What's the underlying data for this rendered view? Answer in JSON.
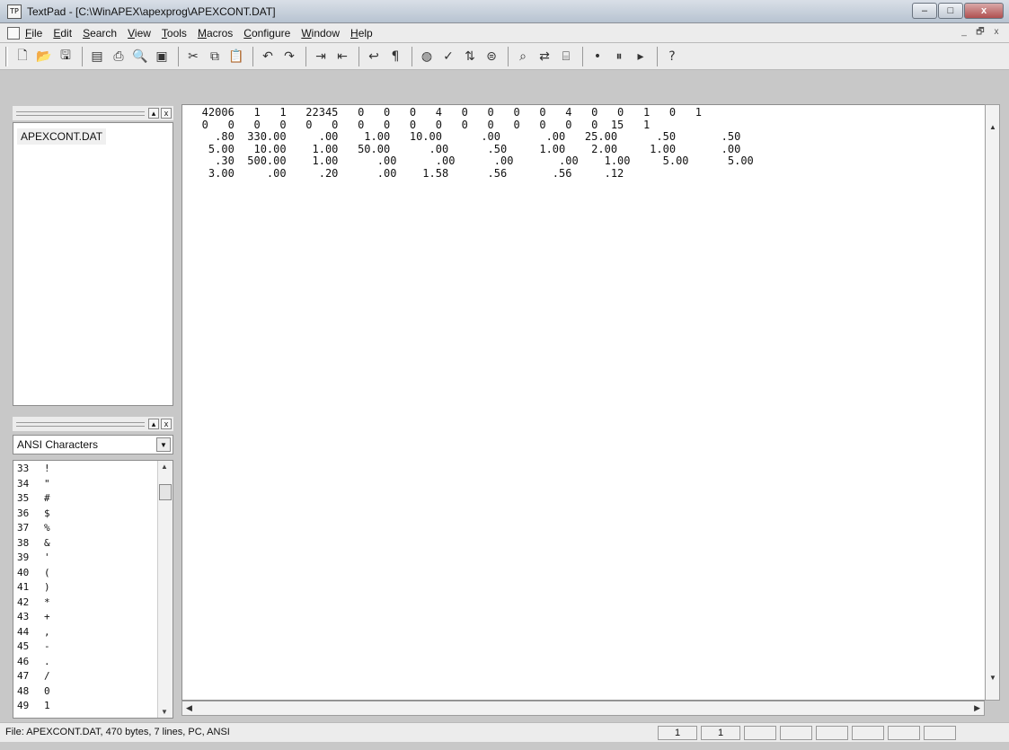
{
  "window": {
    "title": "TextPad - [C:\\WinAPEX\\apexprog\\APEXCONT.DAT]",
    "app_icon": "TP"
  },
  "window_controls": {
    "minimize": "–",
    "maximize": "□",
    "close": "x"
  },
  "menu": {
    "items": [
      "File",
      "Edit",
      "Search",
      "View",
      "Tools",
      "Macros",
      "Configure",
      "Window",
      "Help"
    ],
    "mdi_controls": {
      "minimize": "_",
      "restore": "🗗",
      "close": "x"
    }
  },
  "toolbar": {
    "icons": [
      "new-icon",
      "open-icon",
      "save-icon",
      "save-all-icon",
      "print-icon",
      "print-preview-icon",
      "manage-files-icon",
      "cut-icon",
      "copy-icon",
      "paste-icon",
      "undo-icon",
      "redo-icon",
      "indent-icon",
      "outdent-icon",
      "word-wrap-icon",
      "visible-spaces-icon",
      "web-icon",
      "spelling-icon",
      "sort-icon",
      "compare-icon",
      "find-icon",
      "replace-icon",
      "find-in-files-icon",
      "bookmark-icon",
      "record-macro-icon",
      "play-macro-icon",
      "context-help-icon"
    ]
  },
  "doc_panel": {
    "items": [
      "APEXCONT.DAT"
    ]
  },
  "char_panel": {
    "selected": "ANSI Characters",
    "rows": [
      {
        "code": "33",
        "char": "!"
      },
      {
        "code": "34",
        "char": "\""
      },
      {
        "code": "35",
        "char": "#"
      },
      {
        "code": "36",
        "char": "$"
      },
      {
        "code": "37",
        "char": "%"
      },
      {
        "code": "38",
        "char": "&"
      },
      {
        "code": "39",
        "char": "'"
      },
      {
        "code": "40",
        "char": "("
      },
      {
        "code": "41",
        "char": ")"
      },
      {
        "code": "42",
        "char": "*"
      },
      {
        "code": "43",
        "char": "+"
      },
      {
        "code": "44",
        "char": ","
      },
      {
        "code": "45",
        "char": "-"
      },
      {
        "code": "46",
        "char": "."
      },
      {
        "code": "47",
        "char": "/"
      },
      {
        "code": "48",
        "char": "0"
      },
      {
        "code": "49",
        "char": "1"
      }
    ]
  },
  "editor": {
    "lines": [
      "   42006   1   1   22345   0   0   0   4   0   0   0   0   4   0   0   1   0   1",
      "   0   0   0   0   0   0   0   0   0   0   0   0   0   0   0   0  15   1",
      "     .80  330.00     .00    1.00   10.00      .00       .00   25.00      .50       .50",
      "    5.00   10.00    1.00   50.00      .00      .50     1.00    2.00     1.00       .00",
      "     .30  500.00    1.00      .00      .00      .00       .00    1.00     5.00      5.00",
      "    3.00     .00     .20      .00    1.58      .56       .56     .12"
    ]
  },
  "status": {
    "text": "File: APEXCONT.DAT, 470 bytes, 7 lines, PC, ANSI",
    "line": "1",
    "column": "1"
  }
}
